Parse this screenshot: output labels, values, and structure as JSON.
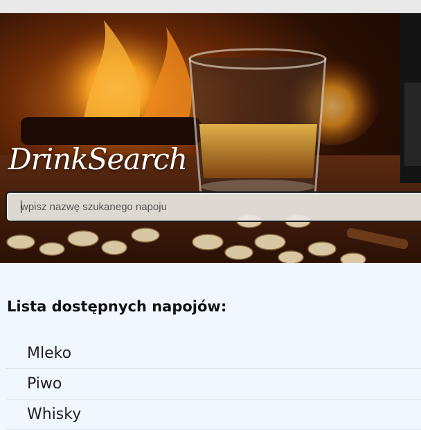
{
  "header": {
    "logo_text": "DrinkSearch"
  },
  "search": {
    "placeholder": "wpisz nazwę szukanego napoju",
    "value": ""
  },
  "list": {
    "title": "Lista dostępnych napojów:",
    "items": [
      "Mleko",
      "Piwo",
      "Whisky"
    ]
  },
  "colors": {
    "page_background": "#f0f7ff",
    "logo_text": "#ffffff",
    "search_border": "#1a1a1a"
  }
}
